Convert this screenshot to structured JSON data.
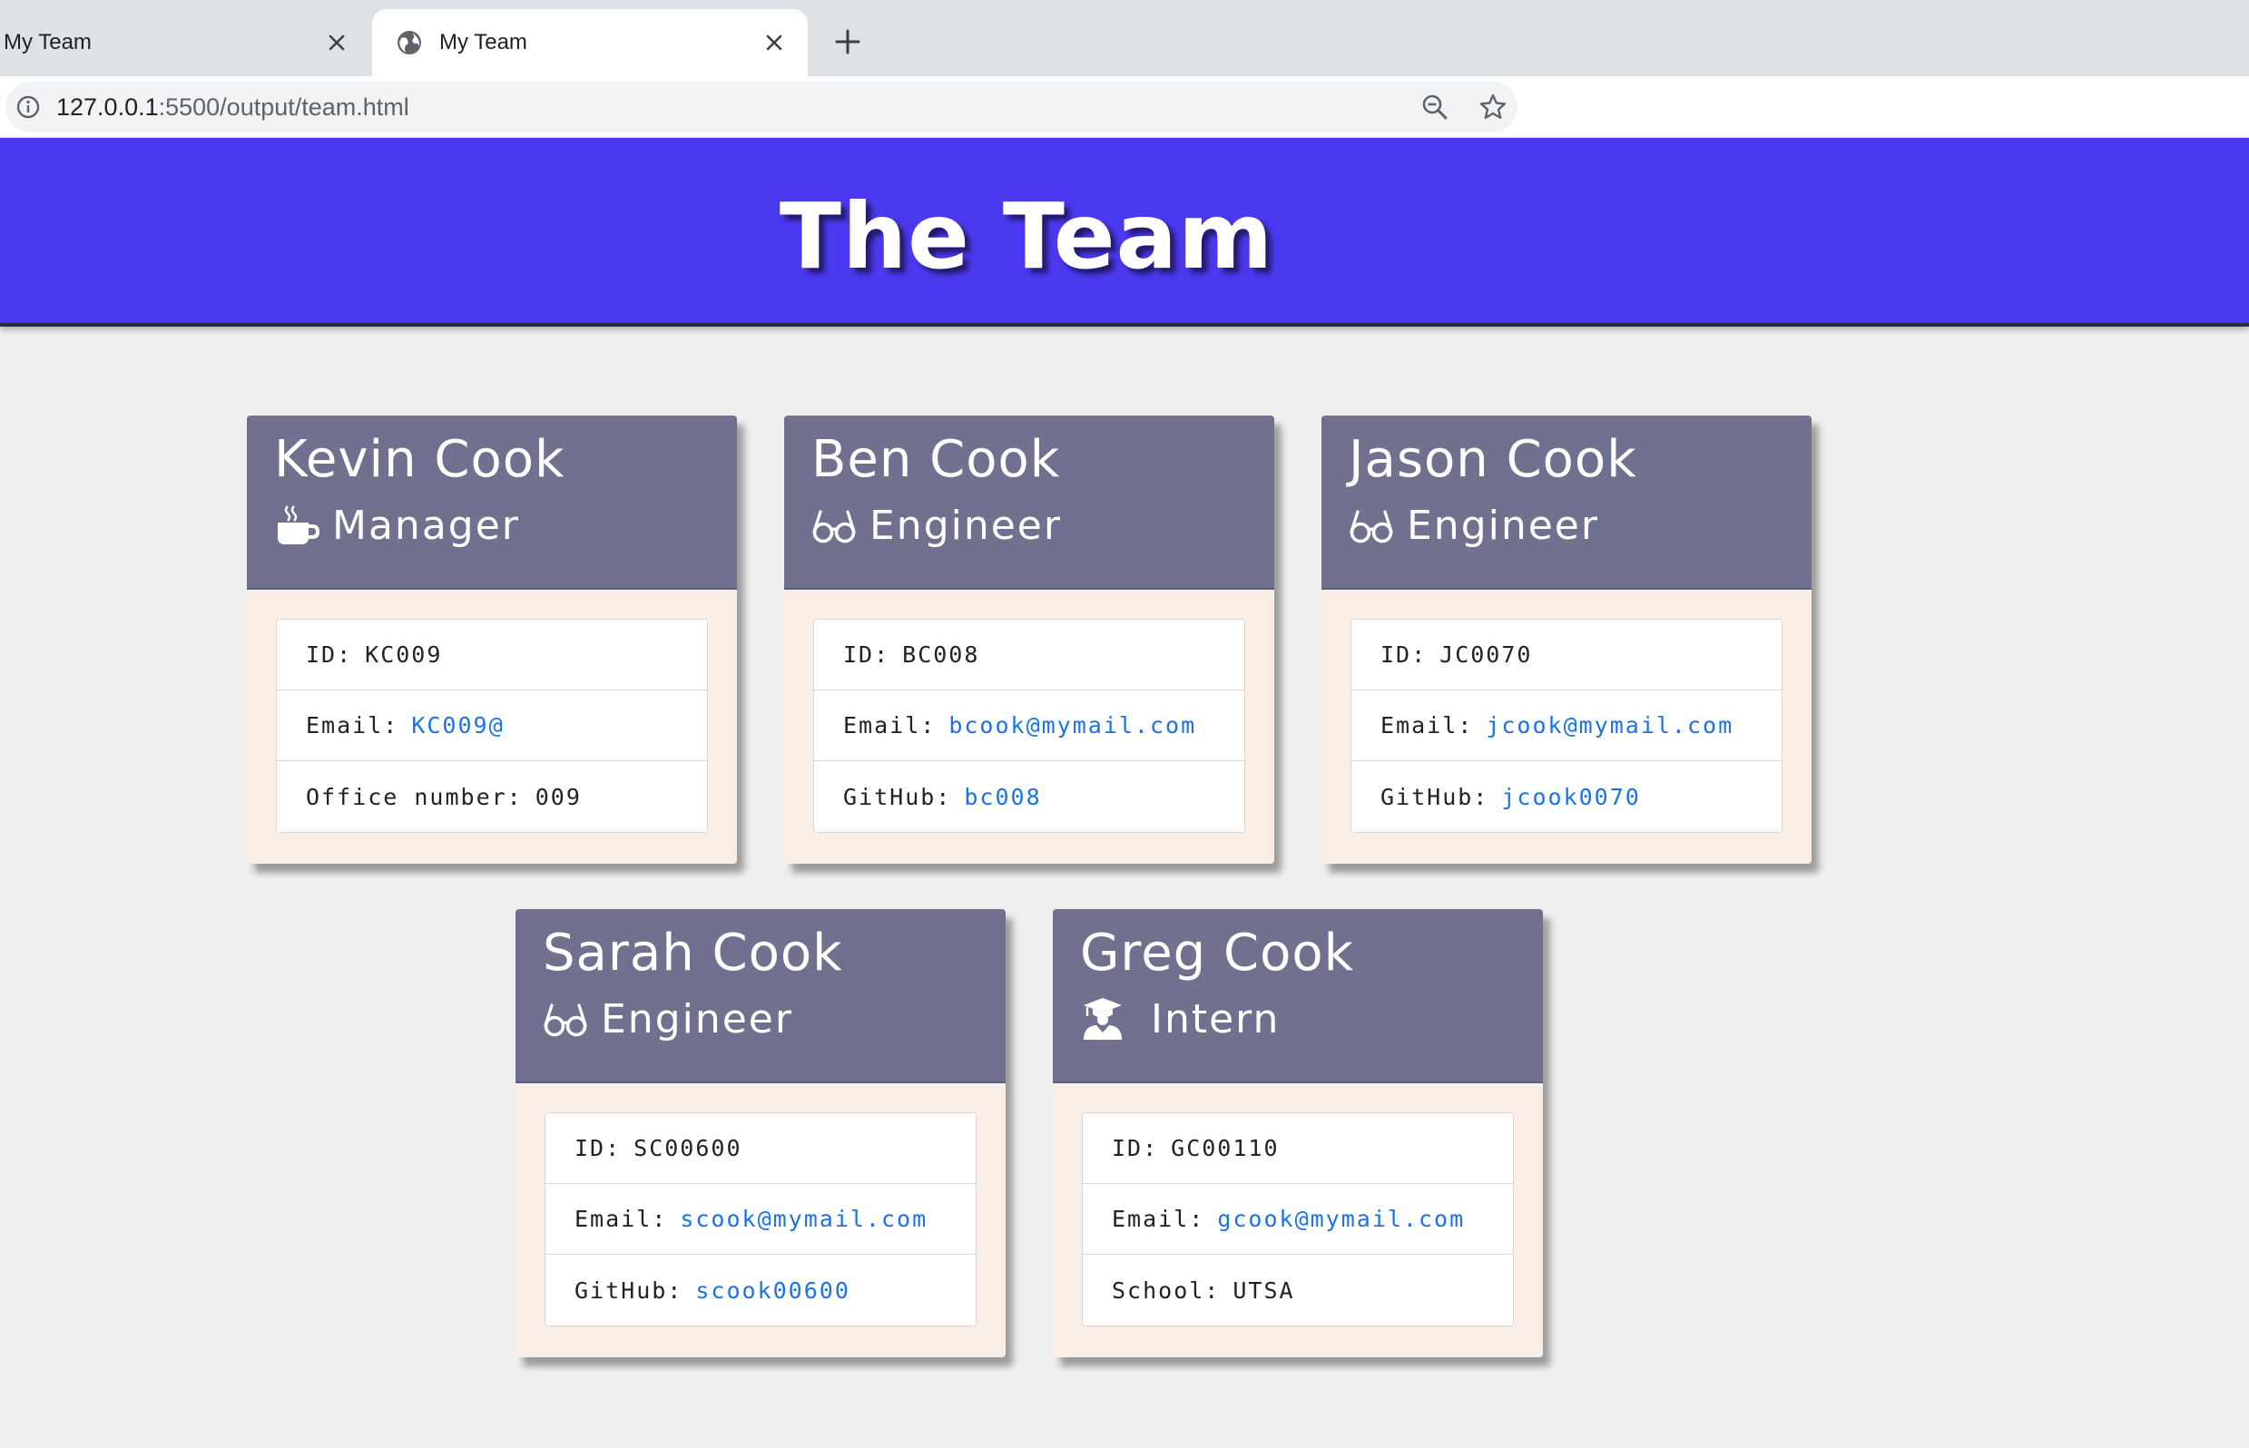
{
  "browser": {
    "tabs": [
      {
        "title": "My Team",
        "active": false
      },
      {
        "title": "My Team",
        "active": true
      }
    ],
    "url_host": "127.0.0.1",
    "url_rest": ":5500/output/team.html",
    "extension_icons": [
      "ec-icon",
      "reel-icon",
      "arrow-icon",
      "html-tree-icon",
      "bug-icon",
      "shield-icon",
      "colors-icon",
      "s-icon",
      "bulb-icon",
      "purple-icon",
      "avatar",
      "alert-icon"
    ]
  },
  "header": {
    "title": "The Team"
  },
  "team": [
    {
      "name": "Kevin Cook",
      "role": "Manager",
      "icon": "coffee-icon",
      "rows": [
        {
          "label": "ID:",
          "value": "KC009"
        },
        {
          "label": "Email:",
          "value": "KC009@",
          "link": true
        },
        {
          "label": "Office number:",
          "value": "009"
        }
      ]
    },
    {
      "name": "Ben Cook",
      "role": "Engineer",
      "icon": "glasses-icon",
      "rows": [
        {
          "label": "ID:",
          "value": "BC008"
        },
        {
          "label": "Email:",
          "value": "bcook@mymail.com",
          "link": true
        },
        {
          "label": "GitHub:",
          "value": "bc008",
          "link": true
        }
      ]
    },
    {
      "name": "Jason Cook",
      "role": "Engineer",
      "icon": "glasses-icon",
      "rows": [
        {
          "label": "ID:",
          "value": "JC0070"
        },
        {
          "label": "Email:",
          "value": "jcook@mymail.com",
          "link": true
        },
        {
          "label": "GitHub:",
          "value": "jcook0070",
          "link": true
        }
      ]
    },
    {
      "name": "Sarah Cook",
      "role": "Engineer",
      "icon": "glasses-icon",
      "rows": [
        {
          "label": "ID:",
          "value": "SC00600"
        },
        {
          "label": "Email:",
          "value": "scook@mymail.com",
          "link": true
        },
        {
          "label": "GitHub:",
          "value": "scook00600",
          "link": true
        }
      ]
    },
    {
      "name": "Greg Cook",
      "role": "Intern",
      "icon": "graduate-icon",
      "rows": [
        {
          "label": "ID:",
          "value": "GC00110"
        },
        {
          "label": "Email:",
          "value": "gcook@mymail.com",
          "link": true
        },
        {
          "label": "School:",
          "value": "UTSA"
        }
      ]
    }
  ]
}
